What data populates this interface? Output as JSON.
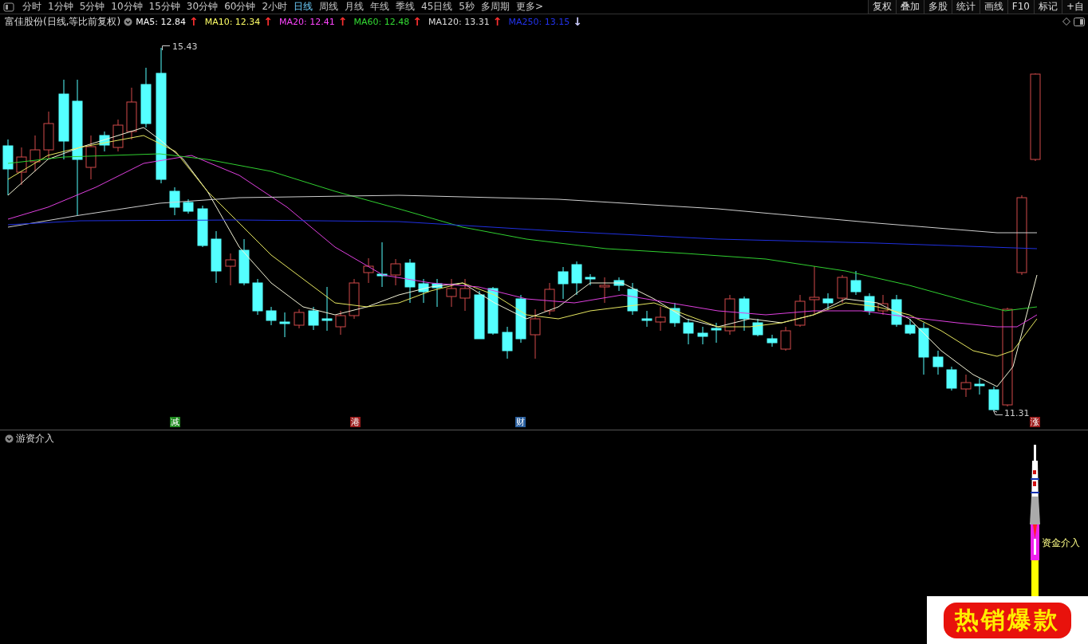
{
  "toolbar": {
    "periods": [
      {
        "label": "分时",
        "selected": false
      },
      {
        "label": "1分钟",
        "selected": false
      },
      {
        "label": "5分钟",
        "selected": false
      },
      {
        "label": "10分钟",
        "selected": false
      },
      {
        "label": "15分钟",
        "selected": false
      },
      {
        "label": "30分钟",
        "selected": false
      },
      {
        "label": "60分钟",
        "selected": false
      },
      {
        "label": "2小时",
        "selected": false
      },
      {
        "label": "日线",
        "selected": true
      },
      {
        "label": "周线",
        "selected": false
      },
      {
        "label": "月线",
        "selected": false
      },
      {
        "label": "年线",
        "selected": false
      },
      {
        "label": "季线",
        "selected": false
      },
      {
        "label": "45日线",
        "selected": false
      },
      {
        "label": "5秒",
        "selected": false
      },
      {
        "label": "多周期",
        "selected": false
      },
      {
        "label": "更多>",
        "selected": false
      }
    ],
    "tools": [
      "复权",
      "叠加",
      "多股",
      "统计",
      "画线",
      "F10",
      "标记",
      "+自"
    ]
  },
  "legend": {
    "title": "富佳股份(日线,等比前复权)",
    "averages": [
      {
        "label": "MA5: 12.84",
        "color": "#ffffff",
        "arrow": {
          "symbol": "↑",
          "color": "#ff3030"
        }
      },
      {
        "label": "MA10: 12.34",
        "color": "#ffff66",
        "arrow": {
          "symbol": "↑",
          "color": "#ff3030"
        }
      },
      {
        "label": "MA20: 12.41",
        "color": "#ff44ff",
        "arrow": {
          "symbol": "↑",
          "color": "#ff3030"
        }
      },
      {
        "label": "MA60: 12.48",
        "color": "#33dd33",
        "arrow": {
          "symbol": "↑",
          "color": "#ff3030"
        }
      },
      {
        "label": "MA120: 13.31",
        "color": "#dddddd",
        "arrow": {
          "symbol": "↑",
          "color": "#ff3030"
        }
      },
      {
        "label": "MA250: 13.15",
        "color": "#2233ee",
        "arrow": {
          "symbol": "↓",
          "color": "#ccccff"
        }
      }
    ]
  },
  "chart": {
    "high_label": "15.43",
    "low_label": "11.31",
    "events": [
      {
        "label": "减",
        "color": "#1f8a1f"
      },
      {
        "label": "港",
        "color": "#9a1a1a"
      },
      {
        "label": "财",
        "color": "#2a5f9e"
      },
      {
        "label": "涨",
        "color": "#9a1a1a"
      }
    ]
  },
  "indicator": {
    "title": "游资介入",
    "signal_label": "资金介入"
  },
  "banner": {
    "text": "热销爆款"
  }
}
